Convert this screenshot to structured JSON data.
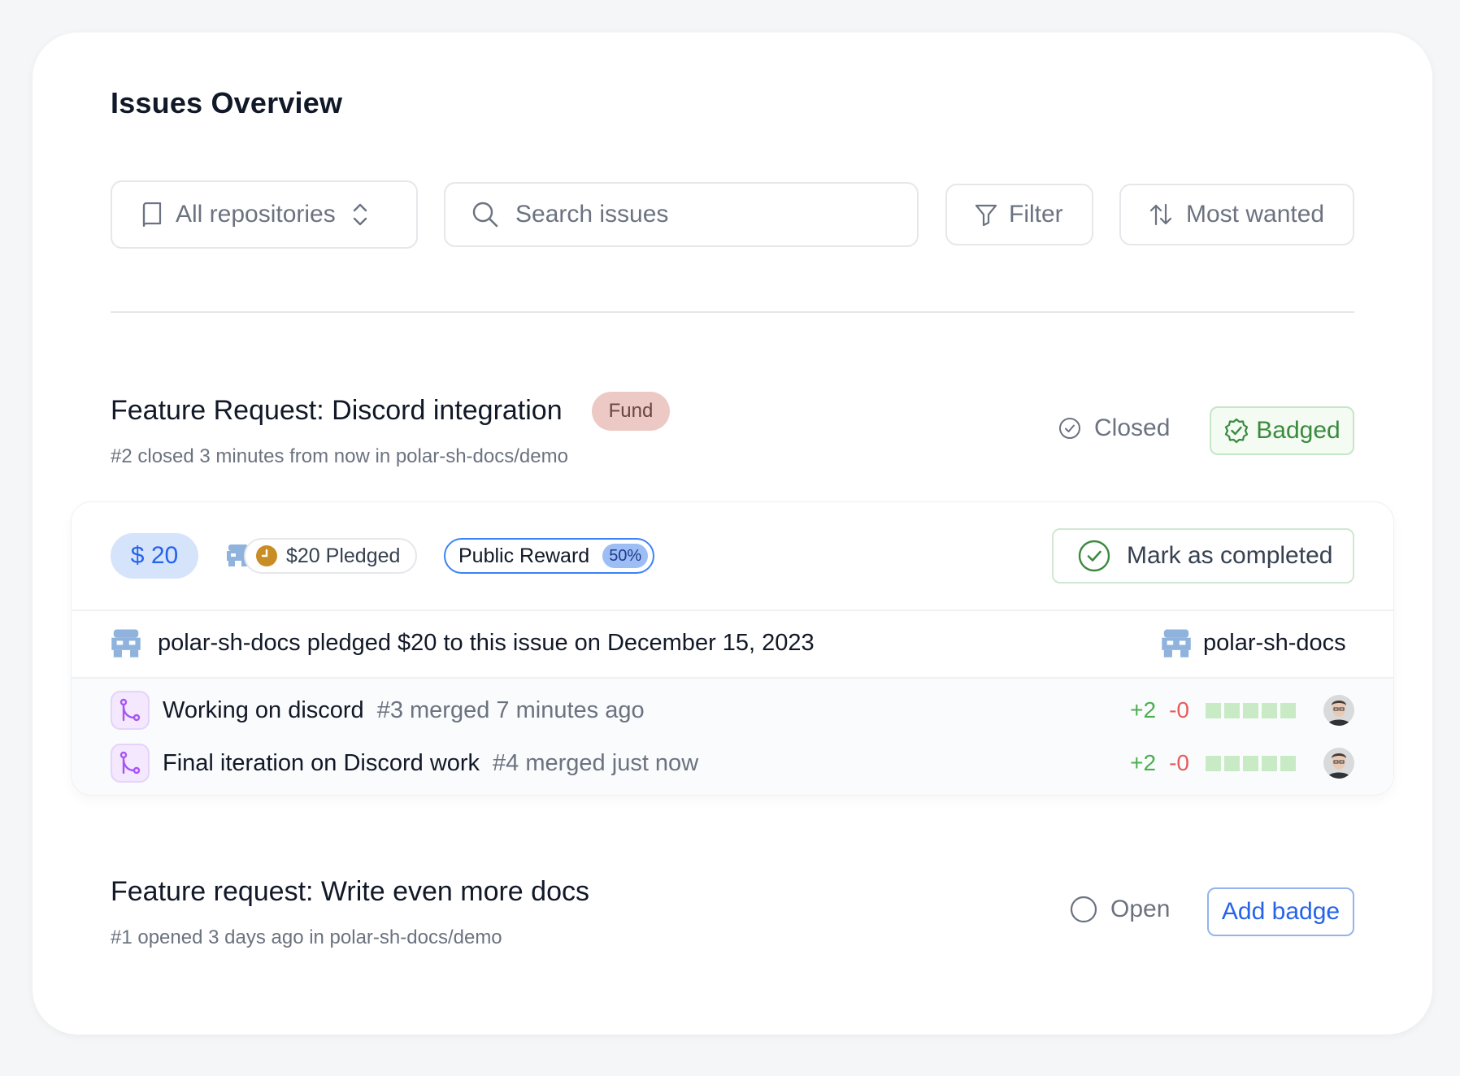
{
  "page": {
    "title": "Issues Overview"
  },
  "toolbar": {
    "repo_select": "All repositories",
    "search_placeholder": "Search issues",
    "filter_label": "Filter",
    "sort_label": "Most wanted"
  },
  "issues": [
    {
      "title": "Feature Request: Discord integration",
      "badge": "Fund",
      "meta": "#2 closed 3 minutes from now in polar-sh-docs/demo",
      "status": "Closed",
      "action": "Badged",
      "funding": {
        "amount": "$ 20",
        "pledged": "$20 Pledged",
        "reward_label": "Public Reward",
        "reward_percent": "50%",
        "complete_button": "Mark as completed"
      },
      "pledge_text": "polar-sh-docs pledged $20 to this issue on December 15, 2023",
      "pledger": "polar-sh-docs",
      "pull_requests": [
        {
          "title": "Working on discord",
          "meta": "#3 merged 7 minutes ago",
          "additions": "+2",
          "deletions": "-0"
        },
        {
          "title": "Final iteration on Discord work",
          "meta": "#4 merged just now",
          "additions": "+2",
          "deletions": "-0"
        }
      ]
    },
    {
      "title": "Feature request: Write even more docs",
      "meta": "#1 opened 3 days ago in polar-sh-docs/demo",
      "status": "Open",
      "action": "Add badge"
    }
  ],
  "colors": {
    "accent_blue": "#2563eb",
    "success_green": "#3b8a3e",
    "fund_badge_bg": "#ecc9c4",
    "pr_purple": "#a855f7"
  },
  "icons": [
    "book-icon",
    "chevron-updown-icon",
    "search-icon",
    "filter-icon",
    "sort-icon",
    "check-circle-icon",
    "badge-check-icon",
    "clock-icon",
    "merge-icon",
    "circle-icon",
    "org-avatar",
    "user-avatar"
  ]
}
